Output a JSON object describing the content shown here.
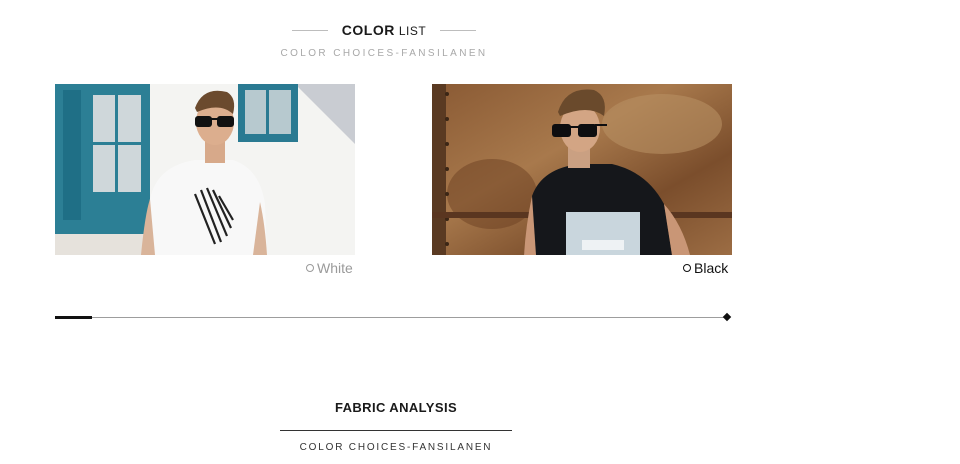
{
  "color_section": {
    "title_bold": "COLOR",
    "title_light": "LIST",
    "subtitle": "COLOR CHOICES-FANSILANEN"
  },
  "products": [
    {
      "color_label": "White",
      "image": "man-white-tshirt-photo"
    },
    {
      "color_label": "Black",
      "image": "man-black-tshirt-photo"
    }
  ],
  "slider": {
    "position": 0.05
  },
  "fabric_section": {
    "title": "FABRIC ANALYSIS",
    "subtitle": "COLOR CHOICES-FANSILANEN"
  },
  "colors": {
    "text_dark": "#1a1a1a",
    "text_muted": "#a8a8a8",
    "accent": "#111111"
  }
}
